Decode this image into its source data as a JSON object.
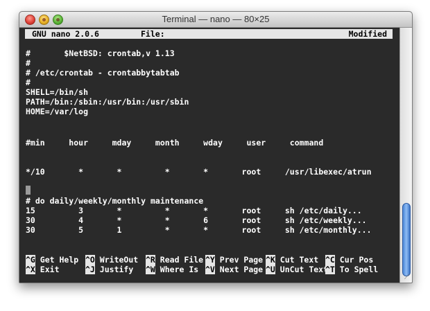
{
  "window": {
    "title": "Terminal — nano — 80×25"
  },
  "nano_header": {
    "version": "GNU nano 2.0.6",
    "file_label": "File:",
    "status": "Modified"
  },
  "file_lines": [
    "#       $NetBSD: crontab,v 1.13",
    "#",
    "# /etc/crontab - crontabbytabtab",
    "#",
    "SHELL=/bin/sh",
    "PATH=/bin:/sbin:/usr/bin:/usr/sbin",
    "HOME=/var/log",
    "",
    "",
    "#min     hour     mday     month     wday     user     command",
    "",
    "",
    "*/10       *       *         *       *       root     /usr/libexec/atrun",
    "",
    "",
    "# do daily/weekly/monthly maintenance",
    "15         3       *         *       *       root     sh /etc/daily...",
    "30         4       *         *       6       root     sh /etc/weekly...",
    "30         5       1         *       *       root     sh /etc/monthly..."
  ],
  "shortcuts_row1": [
    {
      "key": "^G",
      "label": "Get Help"
    },
    {
      "key": "^O",
      "label": "WriteOut"
    },
    {
      "key": "^R",
      "label": "Read File"
    },
    {
      "key": "^Y",
      "label": "Prev Page"
    },
    {
      "key": "^K",
      "label": "Cut Text"
    },
    {
      "key": "^C",
      "label": "Cur Pos"
    }
  ],
  "shortcuts_row2": [
    {
      "key": "^X",
      "label": "Exit"
    },
    {
      "key": "^J",
      "label": "Justify"
    },
    {
      "key": "^W",
      "label": "Where Is"
    },
    {
      "key": "^V",
      "label": "Next Page"
    },
    {
      "key": "^U",
      "label": "UnCut Text"
    },
    {
      "key": "^T",
      "label": "To Spell"
    }
  ],
  "icons": {
    "close": "close-icon",
    "minimize": "minimize-icon",
    "zoom": "zoom-icon",
    "resize": "resize-grip-icon"
  },
  "colors": {
    "terminal_bg": "#2a2a2a",
    "terminal_fg": "#ffffff",
    "inverse_bar": "#e6e6e6",
    "scroll_thumb": "#5b92df"
  }
}
